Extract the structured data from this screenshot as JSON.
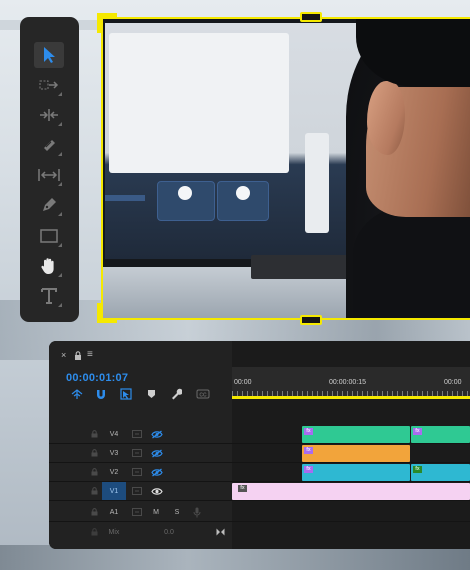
{
  "colors": {
    "selection_yellow": "#f5e900",
    "timecode_blue": "#2d8ceb",
    "clip_green": "#2fc993",
    "clip_orange": "#f2a43b",
    "clip_cyan": "#2eb8d2",
    "clip_pink": "#f5d2f2",
    "clip_fx_purple": "#a86cf0"
  },
  "tools": [
    {
      "name": "selection-tool",
      "icon": "arrow-icon",
      "active": true
    },
    {
      "name": "track-select-tool",
      "icon": "track-select-icon"
    },
    {
      "name": "ripple-edit-tool",
      "icon": "ripple-edit-icon"
    },
    {
      "name": "razor-tool",
      "icon": "razor-icon"
    },
    {
      "name": "slip-tool",
      "icon": "slip-icon"
    },
    {
      "name": "pen-tool",
      "icon": "pen-icon"
    },
    {
      "name": "rectangle-tool",
      "icon": "rectangle-icon"
    },
    {
      "name": "hand-tool",
      "icon": "hand-icon"
    },
    {
      "name": "type-tool",
      "icon": "type-icon"
    }
  ],
  "timeline": {
    "close_glyph": "×",
    "lock_glyph": "🔒",
    "menu_glyph": "≡",
    "timecode": "00:00:01:07",
    "ruler": [
      "00:00",
      "00:00:00:15",
      "00:00"
    ],
    "tracks": [
      {
        "label": "V4"
      },
      {
        "label": "V3"
      },
      {
        "label": "V2"
      },
      {
        "label": "V1"
      },
      {
        "label": "A1",
        "m": "M",
        "s": "S"
      },
      {
        "label": "Mix",
        "value": "0.0"
      }
    ],
    "clip_fx_label": "fx"
  }
}
